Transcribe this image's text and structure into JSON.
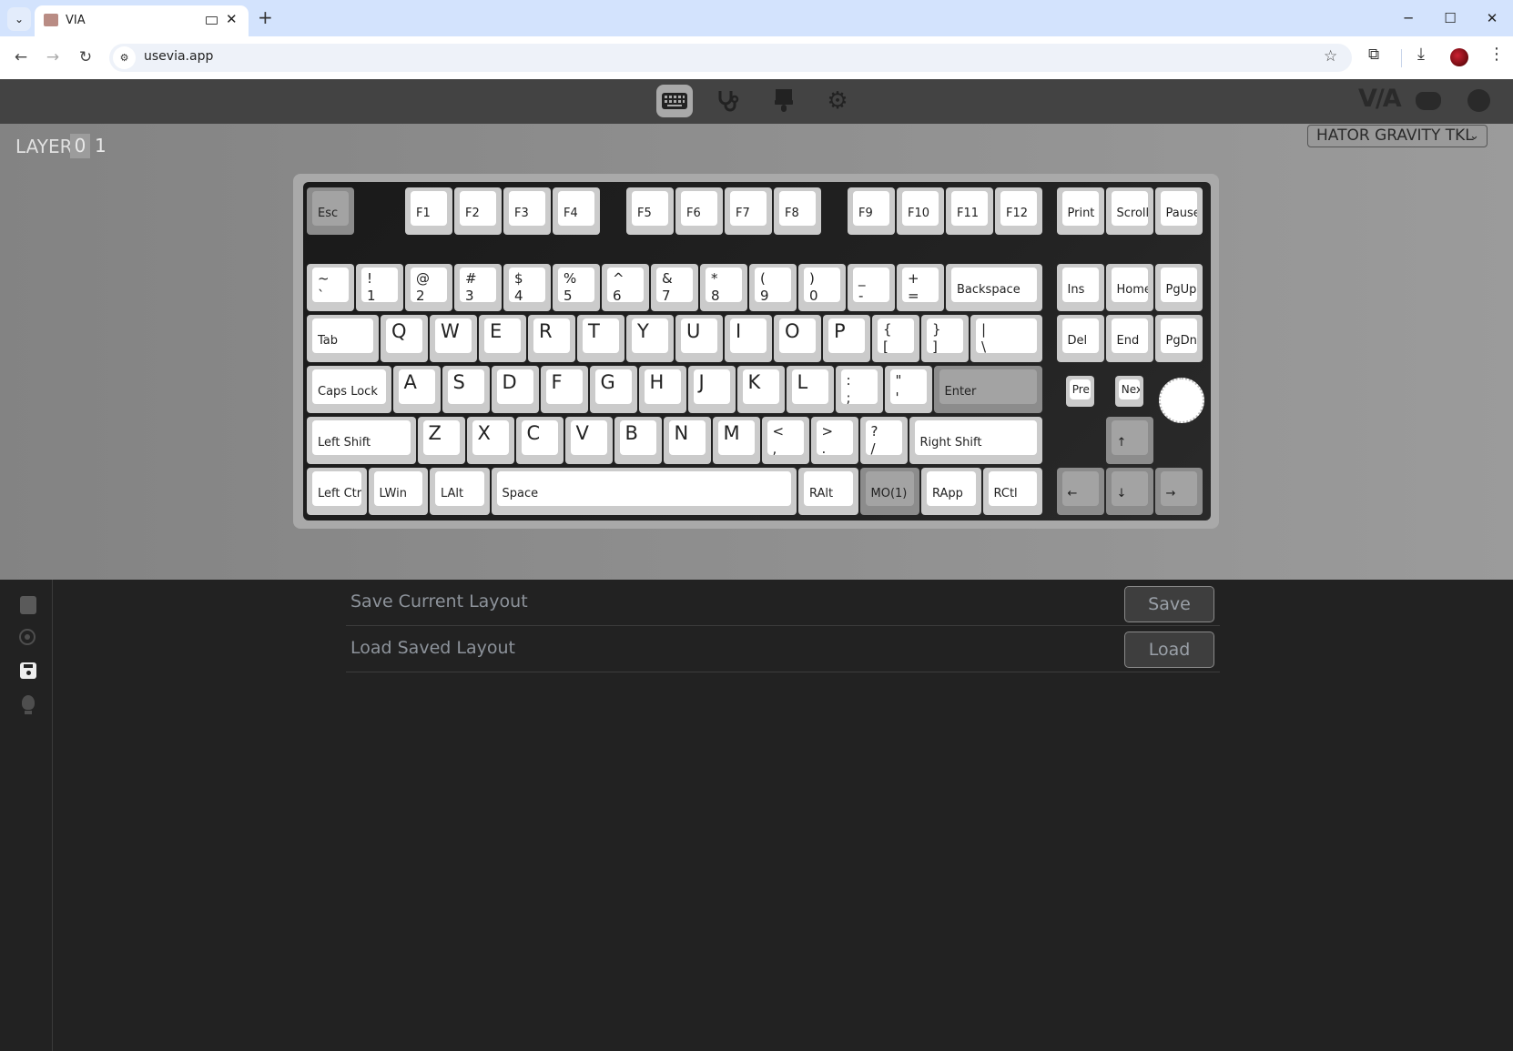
{
  "browser": {
    "tab_title": "VIA",
    "url": "usevia.app"
  },
  "header": {
    "nav_icons": [
      "keyboard-icon",
      "stethoscope-icon",
      "paintbrush-icon",
      "gear-icon"
    ],
    "selected": "keyboard-icon",
    "logo": "V/A",
    "right_icons": [
      "discord-icon",
      "github-icon"
    ]
  },
  "layer": {
    "label": "LAYER",
    "options": [
      "0",
      "1"
    ],
    "selected": "0"
  },
  "device_select": {
    "value": "HATOR GRAVITY TKL"
  },
  "keyboard": {
    "rows": [
      [
        {
          "l": "Esc",
          "dark": true
        },
        {
          "l": "F1"
        },
        {
          "l": "F2"
        },
        {
          "l": "F3"
        },
        {
          "l": "F4"
        },
        {
          "l": "F5"
        },
        {
          "l": "F6"
        },
        {
          "l": "F7"
        },
        {
          "l": "F8"
        },
        {
          "l": "F9"
        },
        {
          "l": "F10"
        },
        {
          "l": "F11"
        },
        {
          "l": "F12"
        },
        {
          "l": "Print"
        },
        {
          "l": "Scroll"
        },
        {
          "l": "Pause"
        }
      ],
      [
        {
          "t": "~",
          "b": "`"
        },
        {
          "t": "!",
          "b": "1"
        },
        {
          "t": "@",
          "b": "2"
        },
        {
          "t": "#",
          "b": "3"
        },
        {
          "t": "$",
          "b": "4"
        },
        {
          "t": "%",
          "b": "5"
        },
        {
          "t": "^",
          "b": "6"
        },
        {
          "t": "&",
          "b": "7"
        },
        {
          "t": "*",
          "b": "8"
        },
        {
          "t": "(",
          "b": "9"
        },
        {
          "t": ")",
          "b": "0"
        },
        {
          "t": "_",
          "b": "-"
        },
        {
          "t": "+",
          "b": "="
        },
        {
          "l": "Backspace"
        },
        {
          "l": "Ins"
        },
        {
          "l": "Home"
        },
        {
          "l": "PgUp"
        }
      ],
      [
        {
          "l": "Tab"
        },
        {
          "l": "Q"
        },
        {
          "l": "W"
        },
        {
          "l": "E"
        },
        {
          "l": "R"
        },
        {
          "l": "T"
        },
        {
          "l": "Y"
        },
        {
          "l": "U"
        },
        {
          "l": "I"
        },
        {
          "l": "O"
        },
        {
          "l": "P"
        },
        {
          "t": "{",
          "b": "["
        },
        {
          "t": "}",
          "b": "]"
        },
        {
          "t": "|",
          "b": "\\"
        },
        {
          "l": "Del"
        },
        {
          "l": "End"
        },
        {
          "l": "PgDn"
        }
      ],
      [
        {
          "l": "Caps Lock"
        },
        {
          "l": "A"
        },
        {
          "l": "S"
        },
        {
          "l": "D"
        },
        {
          "l": "F"
        },
        {
          "l": "G"
        },
        {
          "l": "H"
        },
        {
          "l": "J"
        },
        {
          "l": "K"
        },
        {
          "l": "L"
        },
        {
          "t": ":",
          "b": ";"
        },
        {
          "t": "\"",
          "b": "'"
        },
        {
          "l": "Enter",
          "dark": true
        },
        {
          "l": "Pre"
        },
        {
          "l": "Nex"
        }
      ],
      [
        {
          "l": "Left Shift"
        },
        {
          "l": "Z"
        },
        {
          "l": "X"
        },
        {
          "l": "C"
        },
        {
          "l": "V"
        },
        {
          "l": "B"
        },
        {
          "l": "N"
        },
        {
          "l": "M"
        },
        {
          "t": "<",
          "b": ","
        },
        {
          "t": ">",
          "b": "."
        },
        {
          "t": "?",
          "b": "/"
        },
        {
          "l": "Right Shift"
        },
        {
          "l": "↑",
          "dark": true
        }
      ],
      [
        {
          "l": "Left Ctrl"
        },
        {
          "l": "LWin"
        },
        {
          "l": "LAlt"
        },
        {
          "l": "Space"
        },
        {
          "l": "RAlt"
        },
        {
          "l": "MO(1)",
          "dark": true
        },
        {
          "l": "RApp"
        },
        {
          "l": "RCtl"
        },
        {
          "l": "←",
          "dark": true
        },
        {
          "l": "↓",
          "dark": true
        },
        {
          "l": "→",
          "dark": true
        }
      ]
    ],
    "encoder": "rotary-knob"
  },
  "sidebar": {
    "icons": [
      "book-icon",
      "circle-dot-icon",
      "floppy-save-icon",
      "lightbulb-icon"
    ],
    "active": "floppy-save-icon"
  },
  "panel": {
    "rows": [
      {
        "label": "Save Current Layout",
        "button": "Save"
      },
      {
        "label": "Load Saved Layout",
        "button": "Load"
      }
    ]
  },
  "colors": {
    "header": "#434343",
    "panel_bg": "#222222",
    "key": "#ffffff",
    "key_dark": "#a3a3a3",
    "tabbar": "#d3e3fd"
  }
}
